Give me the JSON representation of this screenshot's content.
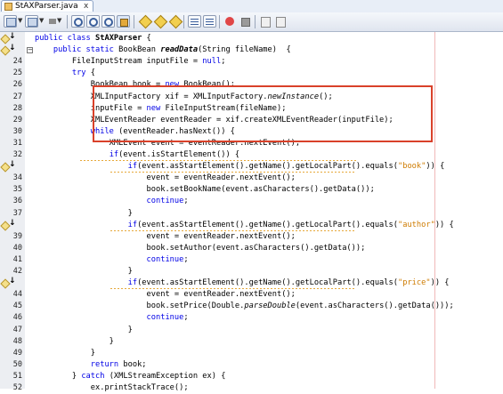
{
  "tab": {
    "title": "StAXParser.java",
    "close": "x"
  },
  "toolbar": {
    "buttons": [
      "back-icon",
      "last-edit-icon",
      "find-icon",
      "find-previous-icon",
      "find-next-icon",
      "toggle-highlight-icon",
      "find-selection-icon",
      "previous-bookmark-icon",
      "next-bookmark-icon",
      "toggle-bookmark-icon",
      "shift-left-icon",
      "shift-right-icon",
      "record-macro-icon",
      "stop-macro-icon"
    ]
  },
  "editor": {
    "lines": [
      {
        "num": "",
        "text": [
          [
            "kw",
            "public class "
          ],
          [
            "b",
            "StAXParser"
          ],
          [
            "",
            " {"
          ]
        ]
      },
      {
        "num": "",
        "text": [
          [
            "",
            "    "
          ],
          [
            "kw",
            "public static "
          ],
          [
            "",
            "BookBean "
          ],
          [
            "bi",
            "readData"
          ],
          [
            "",
            "(String fileName)  {"
          ]
        ]
      },
      {
        "num": "24",
        "text": [
          [
            "",
            "        FileInputStream inputFile = "
          ],
          [
            "kw",
            "null"
          ],
          [
            "",
            ";"
          ]
        ]
      },
      {
        "num": "25",
        "text": [
          [
            "",
            "        "
          ],
          [
            "kw",
            "try"
          ],
          [
            "",
            " {"
          ]
        ]
      },
      {
        "num": "26",
        "text": [
          [
            "",
            "            BookBean book = "
          ],
          [
            "kw",
            "new"
          ],
          [
            "",
            " BookBean();"
          ]
        ]
      },
      {
        "num": "27",
        "text": [
          [
            "",
            "            XMLInputFactory xif = XMLInputFactory."
          ],
          [
            "it",
            "newInstance"
          ],
          [
            "",
            "();"
          ]
        ]
      },
      {
        "num": "28",
        "text": [
          [
            "",
            "            inputFile = "
          ],
          [
            "kw",
            "new"
          ],
          [
            "",
            " FileInputStream(fileName);"
          ]
        ]
      },
      {
        "num": "29",
        "text": [
          [
            "",
            "            XMLEventReader eventReader = xif.createXMLEventReader(inputFile);"
          ]
        ]
      },
      {
        "num": "30",
        "text": [
          [
            "",
            "            "
          ],
          [
            "kw",
            "while"
          ],
          [
            "",
            " (eventReader.hasNext()) {"
          ]
        ]
      },
      {
        "num": "31",
        "text": [
          [
            "",
            "                XMLEvent event = eventReader.nextEvent();"
          ]
        ]
      },
      {
        "num": "32",
        "text": [
          [
            "",
            "                "
          ],
          [
            "kw",
            "if"
          ],
          [
            "",
            "(event.isStartElement()) {"
          ]
        ]
      },
      {
        "num": "",
        "text": [
          [
            "",
            "                    "
          ],
          [
            "kw",
            "if"
          ],
          [
            "",
            "(event.asStartElement().getName().getLocalPart().equals("
          ],
          [
            "str",
            "\"book\""
          ],
          [
            "",
            ")) {"
          ]
        ]
      },
      {
        "num": "34",
        "text": [
          [
            "",
            "                        event = eventReader.nextEvent();"
          ]
        ]
      },
      {
        "num": "35",
        "text": [
          [
            "",
            "                        book.setBookName(event.asCharacters().getData());"
          ]
        ]
      },
      {
        "num": "36",
        "text": [
          [
            "",
            "                        "
          ],
          [
            "kw",
            "continue"
          ],
          [
            "",
            ";"
          ]
        ]
      },
      {
        "num": "37",
        "text": [
          [
            "",
            "                    }"
          ]
        ]
      },
      {
        "num": "",
        "text": [
          [
            "",
            "                    "
          ],
          [
            "kw",
            "if"
          ],
          [
            "",
            "(event.asStartElement().getName().getLocalPart().equals("
          ],
          [
            "str",
            "\"author\""
          ],
          [
            "",
            ")) {"
          ]
        ]
      },
      {
        "num": "39",
        "text": [
          [
            "",
            "                        event = eventReader.nextEvent();"
          ]
        ]
      },
      {
        "num": "40",
        "text": [
          [
            "",
            "                        book.setAuthor(event.asCharacters().getData());"
          ]
        ]
      },
      {
        "num": "41",
        "text": [
          [
            "",
            "                        "
          ],
          [
            "kw",
            "continue"
          ],
          [
            "",
            ";"
          ]
        ]
      },
      {
        "num": "42",
        "text": [
          [
            "",
            "                    }"
          ]
        ]
      },
      {
        "num": "",
        "text": [
          [
            "",
            "                    "
          ],
          [
            "kw",
            "if"
          ],
          [
            "",
            "(event.asStartElement().getName().getLocalPart().equals("
          ],
          [
            "str",
            "\"price\""
          ],
          [
            "",
            ")) {"
          ]
        ]
      },
      {
        "num": "44",
        "text": [
          [
            "",
            "                        event = eventReader.nextEvent();"
          ]
        ]
      },
      {
        "num": "45",
        "text": [
          [
            "",
            "                        book.setPrice(Double."
          ],
          [
            "it",
            "parseDouble"
          ],
          [
            "",
            "(event.asCharacters().getData()));"
          ]
        ]
      },
      {
        "num": "46",
        "text": [
          [
            "",
            "                        "
          ],
          [
            "kw",
            "continue"
          ],
          [
            "",
            ";"
          ]
        ]
      },
      {
        "num": "47",
        "text": [
          [
            "",
            "                    }"
          ]
        ]
      },
      {
        "num": "48",
        "text": [
          [
            "",
            "                }"
          ]
        ]
      },
      {
        "num": "49",
        "text": [
          [
            "",
            "            }"
          ]
        ]
      },
      {
        "num": "50",
        "text": [
          [
            "",
            "            "
          ],
          [
            "kw",
            "return"
          ],
          [
            "",
            " book;"
          ]
        ]
      },
      {
        "num": "51",
        "text": [
          [
            "",
            "        } "
          ],
          [
            "kw",
            "catch"
          ],
          [
            "",
            " (XMLStreamException ex) {"
          ]
        ]
      },
      {
        "num": "52",
        "text": [
          [
            "",
            "            ex.printStackTrace();"
          ]
        ]
      }
    ]
  },
  "colors": {
    "keyword": "#0000e6",
    "string": "#ce7b00",
    "highlight_border": "#d9412a"
  }
}
